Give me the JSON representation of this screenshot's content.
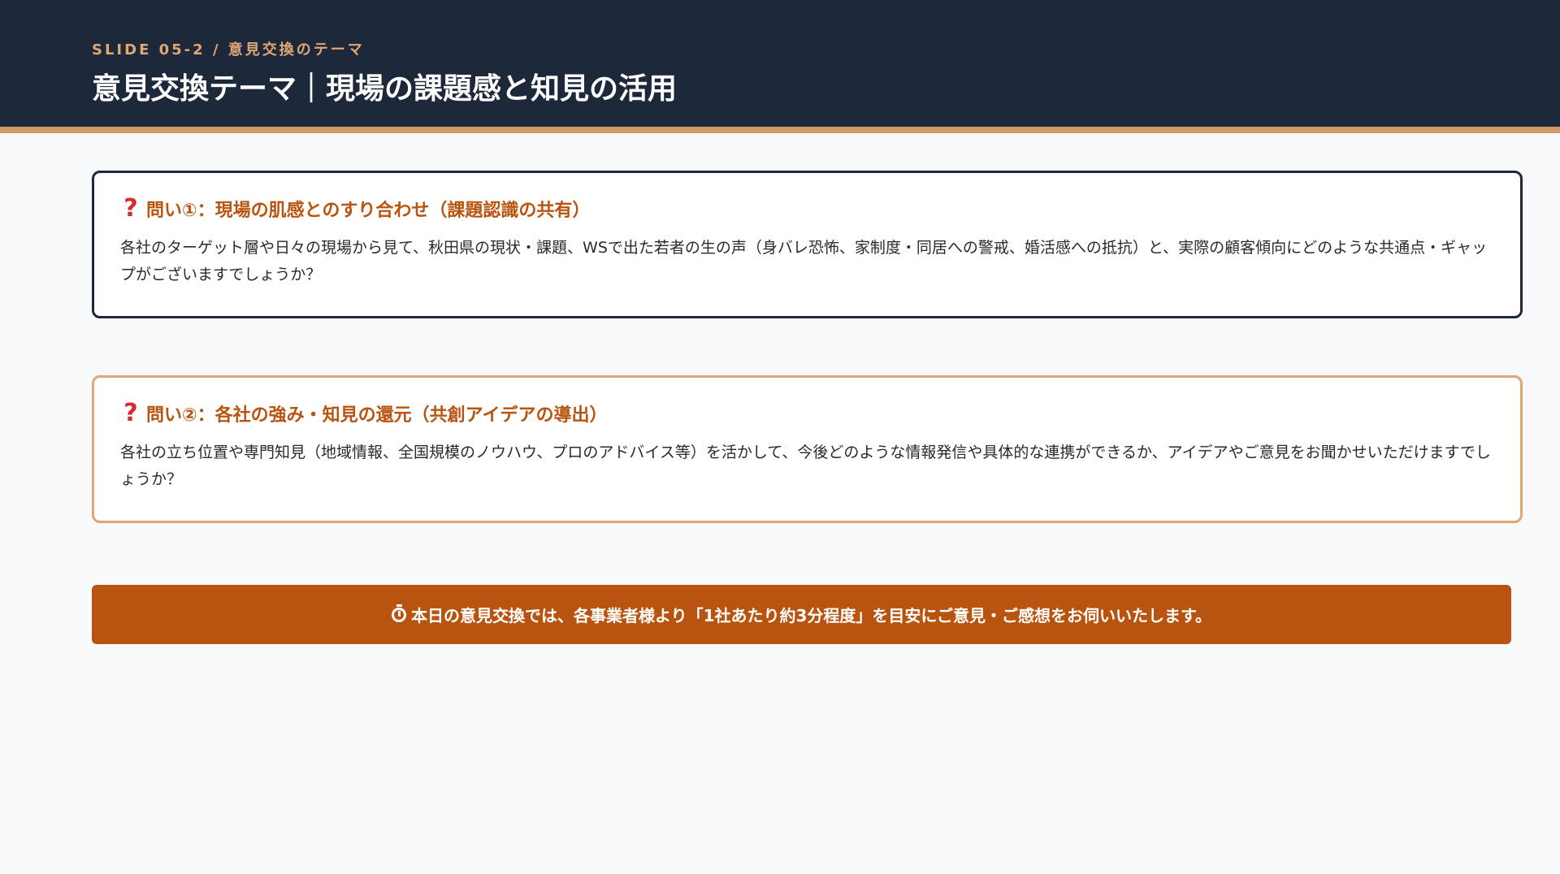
{
  "header": {
    "slide_code": "SLIDE 05-2 / 意見交換のテーマ",
    "title": "意見交換テーマ｜現場の課題感と知見の活用"
  },
  "questions": [
    {
      "icon": "question-mark-icon",
      "title": "問い①：現場の肌感とのすり合わせ（課題認識の共有）",
      "body": "各社のターゲット層や日々の現場から見て、秋田県の現状・課題、WSで出た若者の生の声（身バレ恐怖、家制度・同居への警戒、婚活感への抵抗）と、実際の顧客傾向にどのような共通点・ギャップがございますでしょうか？"
    },
    {
      "icon": "question-mark-icon",
      "title": "問い②：各社の強み・知見の還元（共創アイデアの導出）",
      "body": "各社の立ち位置や専門知見（地域情報、全国規模のノウハウ、プロのアドバイス等）を活かして、今後どのような情報発信や具体的な連携ができるか、アイデアやご意見をお聞かせいただけますでしょうか？"
    }
  ],
  "note": {
    "icon": "timer-icon",
    "text": "本日の意見交換では、各事業者様より「1社あたり約3分程度」を目安にご意見・ご感想をお伺いいたします。"
  },
  "colors": {
    "header_bg": "#1e283b",
    "accent": "#b8540f",
    "accent_light": "#e0a675"
  }
}
